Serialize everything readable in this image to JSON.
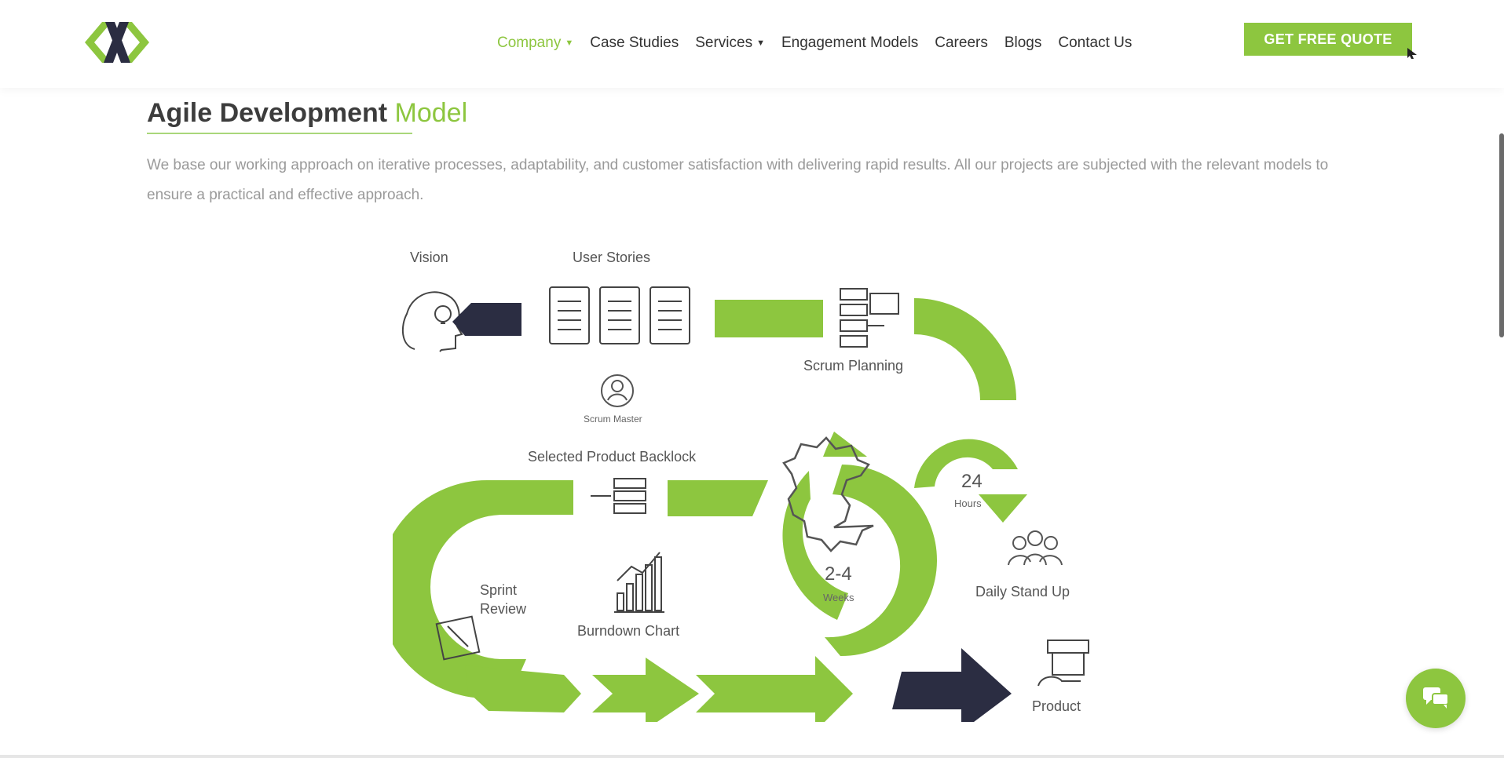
{
  "header": {
    "nav": [
      {
        "label": "Company",
        "dropdown": true,
        "active": true
      },
      {
        "label": "Case Studies",
        "dropdown": false,
        "active": false
      },
      {
        "label": "Services",
        "dropdown": true,
        "active": false
      },
      {
        "label": "Engagement Models",
        "dropdown": false,
        "active": false
      },
      {
        "label": "Careers",
        "dropdown": false,
        "active": false
      },
      {
        "label": "Blogs",
        "dropdown": false,
        "active": false
      },
      {
        "label": "Contact Us",
        "dropdown": false,
        "active": false
      }
    ],
    "cta_label": "GET FREE QUOTE"
  },
  "main": {
    "title_main": "Agile Development",
    "title_accent": "Model",
    "description": "We base our working approach on iterative processes, adaptability, and customer satisfaction with delivering rapid results. All our projects are subjected with the relevant models to ensure a practical and effective approach."
  },
  "diagram": {
    "vision": "Vision",
    "user_stories": "User Stories",
    "scrum_planning": "Scrum Planning",
    "scrum_master": "Scrum Master",
    "selected_backlog": "Selected Product Backlock",
    "hours_value": "24",
    "hours_unit": "Hours",
    "weeks_value": "2-4",
    "weeks_unit": "Weeks",
    "daily_standup": "Daily Stand Up",
    "sprint_review_1": "Sprint",
    "sprint_review_2": "Review",
    "burndown": "Burndown Chart",
    "product": "Product"
  },
  "colors": {
    "accent": "#8dc63f",
    "dark": "#2b2d42",
    "text": "#3a3a3a",
    "muted": "#9a9a9a"
  },
  "icons": [
    "logo-mark",
    "cursor-icon",
    "chat-icon",
    "vision-head-icon",
    "document-icon",
    "scrum-planning-icon",
    "scrum-master-icon",
    "backlog-icon",
    "team-icon",
    "sprint-review-icon",
    "burndown-chart-icon",
    "product-icon",
    "gear-icon"
  ]
}
